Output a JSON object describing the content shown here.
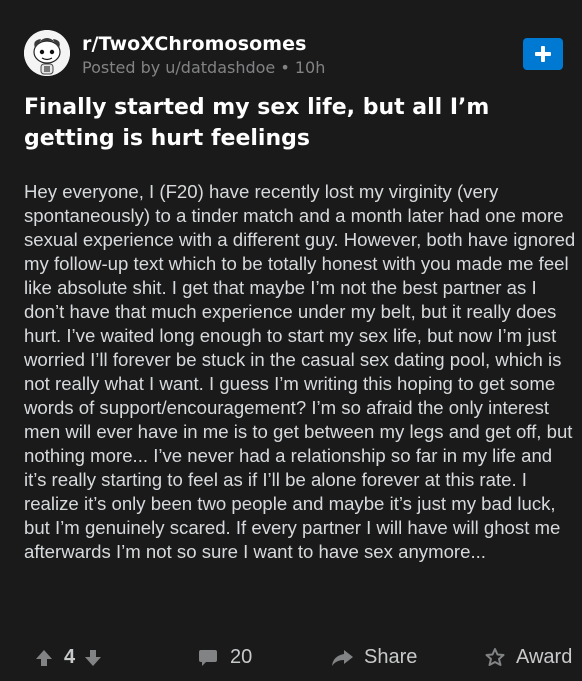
{
  "post": {
    "subreddit": "r/TwoXChromosomes",
    "posted_by": "Posted by u/datdashdoe • 10h",
    "title": "Finally started my sex life, but all I’m getting is hurt feelings",
    "body": "Hey everyone, I (F20) have recently lost my virginity (very spontaneously) to a tinder match and a month later had one more sexual experience with a different guy. However, both have ignored my follow-up text which to be totally honest with you made me feel like absolute shit. I get that maybe I’m not the best partner as I don’t have that much experience under my belt, but it really does hurt. I’ve waited long enough to start my sex life, but now I’m just worried I’ll forever be stuck in the casual sex dating pool, which is not really what I want. I guess I’m writing this hoping to get some words of support/encouragement? I’m so afraid the only interest men will ever have in me is to get between my legs and get off, but nothing more... I’ve never had a relationship so far in my life and it’s really starting to feel as if I’ll be alone forever at this rate. I realize it’s only been two people and maybe it’s just my bad luck, but I’m genuinely scared. If every partner I will have will ghost me afterwards I’m not so sure I want to have sex anymore..."
  },
  "actions": {
    "vote_count": "4",
    "comment_count": "20",
    "share_label": "Share",
    "award_label": "Award"
  },
  "icons": {
    "avatar": "snoo-avatar-icon",
    "join": "plus-icon",
    "upvote": "arrow-up-icon",
    "downvote": "arrow-down-icon",
    "comments": "comment-bubble-icon",
    "share": "share-arrow-icon",
    "award": "award-icon"
  },
  "colors": {
    "background": "#1a1a1b",
    "text": "#d7dadc",
    "muted": "#818384",
    "accent": "#0079d3"
  }
}
